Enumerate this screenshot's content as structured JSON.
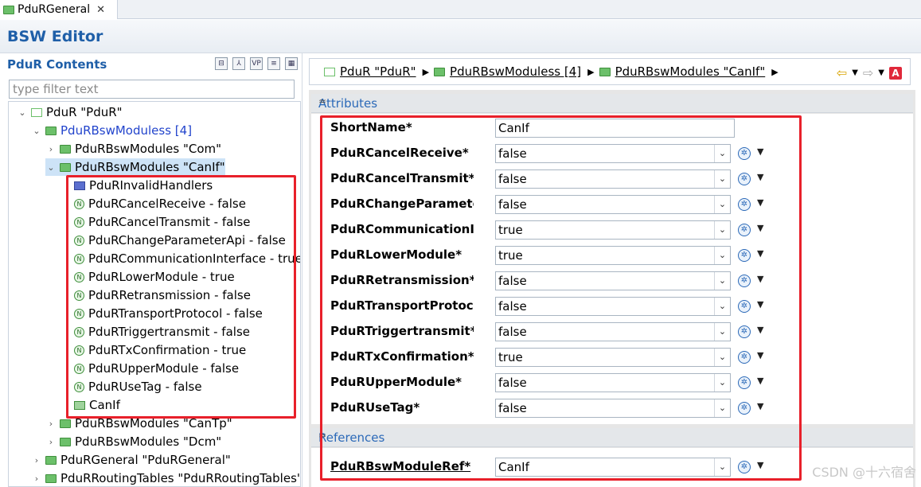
{
  "tab": {
    "label": "PduRGeneral",
    "close": "✕"
  },
  "editor": {
    "title": "BSW Editor"
  },
  "left": {
    "title": "PduR Contents",
    "filter_placeholder": "type filter text",
    "tools": [
      "⊟",
      "⅄",
      "VP",
      "≡",
      "▦"
    ],
    "tree": [
      {
        "label": "PduR \"PduR\"",
        "twisty": "⌄",
        "icon": "module"
      },
      {
        "label": "PduRBswModuless [4]",
        "twisty": "⌄",
        "icon": "folder"
      },
      {
        "label": "PduRBswModules \"Com\"",
        "twisty": "›",
        "icon": "folder"
      },
      {
        "label": "PduRBswModules \"CanIf\"",
        "twisty": "⌄",
        "icon": "folder"
      },
      {
        "label": "PduRInvalidHandlers",
        "twisty": "",
        "icon": "folder-blue"
      },
      {
        "label": "PduRCancelReceive - false",
        "twisty": "",
        "icon": "param"
      },
      {
        "label": "PduRCancelTransmit - false",
        "twisty": "",
        "icon": "param"
      },
      {
        "label": "PduRChangeParameterApi - false",
        "twisty": "",
        "icon": "param"
      },
      {
        "label": "PduRCommunicationInterface - true",
        "twisty": "",
        "icon": "param"
      },
      {
        "label": "PduRLowerModule - true",
        "twisty": "",
        "icon": "param"
      },
      {
        "label": "PduRRetransmission - false",
        "twisty": "",
        "icon": "param"
      },
      {
        "label": "PduRTransportProtocol - false",
        "twisty": "",
        "icon": "param"
      },
      {
        "label": "PduRTriggertransmit - false",
        "twisty": "",
        "icon": "param"
      },
      {
        "label": "PduRTxConfirmation - true",
        "twisty": "",
        "icon": "param"
      },
      {
        "label": "PduRUpperModule - false",
        "twisty": "",
        "icon": "param"
      },
      {
        "label": "PduRUseTag - false",
        "twisty": "",
        "icon": "param"
      },
      {
        "label": "CanIf",
        "twisty": "",
        "icon": "ref"
      },
      {
        "label": "PduRBswModules \"CanTp\"",
        "twisty": "›",
        "icon": "folder"
      },
      {
        "label": "PduRBswModules \"Dcm\"",
        "twisty": "›",
        "icon": "folder"
      },
      {
        "label": "PduRGeneral \"PduRGeneral\"",
        "twisty": "›",
        "icon": "folder"
      },
      {
        "label": "PduRRoutingTables \"PduRRoutingTables\"",
        "twisty": "›",
        "icon": "folder"
      }
    ]
  },
  "breadcrumb": [
    {
      "label": "PduR \"PduR\"",
      "icon": "module"
    },
    {
      "label": "PduRBswModuless [4]",
      "icon": "folder"
    },
    {
      "label": "PduRBswModules \"CanIf\"",
      "icon": "folder"
    }
  ],
  "nav": {
    "back": "⇦",
    "forward": "⇨",
    "a": "A"
  },
  "attributes": {
    "header": "Attributes",
    "rows": [
      {
        "label": "ShortName*",
        "value": "CanIf",
        "kind": "text"
      },
      {
        "label": "PduRCancelReceive*",
        "value": "false",
        "kind": "combo"
      },
      {
        "label": "PduRCancelTransmit*",
        "value": "false",
        "kind": "combo"
      },
      {
        "label": "PduRChangeParameterA",
        "value": "false",
        "kind": "combo"
      },
      {
        "label": "PduRCommunicationInt",
        "value": "true",
        "kind": "combo"
      },
      {
        "label": "PduRLowerModule*",
        "value": "true",
        "kind": "combo"
      },
      {
        "label": "PduRRetransmission*",
        "value": "false",
        "kind": "combo"
      },
      {
        "label": "PduRTransportProtocol",
        "value": "false",
        "kind": "combo"
      },
      {
        "label": "PduRTriggertransmit*",
        "value": "false",
        "kind": "combo"
      },
      {
        "label": "PduRTxConfirmation*",
        "value": "true",
        "kind": "combo"
      },
      {
        "label": "PduRUpperModule*",
        "value": "false",
        "kind": "combo"
      },
      {
        "label": "PduRUseTag*",
        "value": "false",
        "kind": "combo"
      }
    ]
  },
  "references": {
    "header": "References",
    "rows": [
      {
        "label": "PduRBswModuleRef*",
        "value": "CanIf",
        "kind": "combo"
      }
    ]
  },
  "icons": {
    "param": "N",
    "action": "✲",
    "dropdown": "▼",
    "collapse": "≈"
  },
  "watermark": "CSDN @十六宿舍"
}
